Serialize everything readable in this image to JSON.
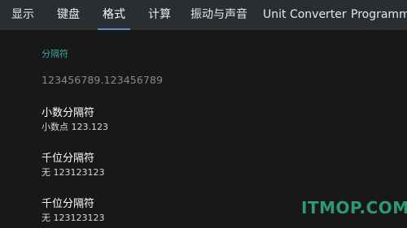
{
  "tabs": [
    {
      "label": "显示"
    },
    {
      "label": "键盘"
    },
    {
      "label": "格式"
    },
    {
      "label": "计算"
    },
    {
      "label": "振动与声音"
    },
    {
      "label": "Unit Converter"
    },
    {
      "label": "Programm"
    }
  ],
  "active_tab": "格式",
  "section": {
    "header": "分隔符",
    "sample_value": "123456789.123456789"
  },
  "preferences": [
    {
      "title": "小数分隔符",
      "summary": "小数点 123.123"
    },
    {
      "title": "千位分隔符",
      "summary": "无 123123123"
    },
    {
      "title": "千位分隔符",
      "summary": "无 123123123"
    }
  ],
  "watermark": "ITMOP.COM",
  "colors": {
    "background": "#181818",
    "tabbar": "#2a2e31",
    "accent_underline": "#5b8fb9",
    "section_header": "#3fa39a",
    "watermark": "#2f9a6e"
  }
}
